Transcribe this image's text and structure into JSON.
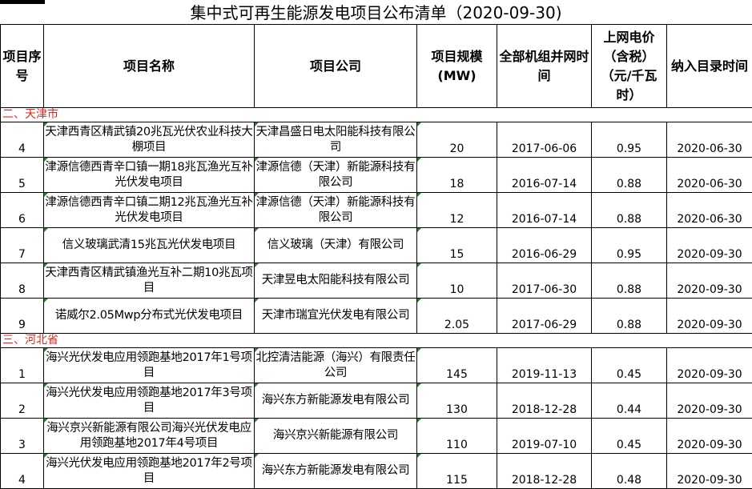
{
  "title": "集中式可再生能源发电项目公布清单（2020-09-30)",
  "headers": {
    "seq": "项目序号",
    "name": "项目名称",
    "company": "项目公司",
    "scale": "项目规模(MW)",
    "grid_time": "全部机组并网时间",
    "price": "上网电价（含税）（元/千瓦时）",
    "list_time": "纳入目录时间"
  },
  "sections": [
    {
      "label": "二、天津市",
      "rows": [
        {
          "seq": "4",
          "name": "天津西青区精武镇20兆瓦光伏农业科技大棚项目",
          "company": "天津昌盛日电太阳能科技有限公司",
          "scale": "20",
          "grid_time": "2017-06-06",
          "price": "0.95",
          "list_time": "2020-06-30"
        },
        {
          "seq": "5",
          "name": "津源信德西青辛口镇一期18兆瓦渔光互补光伏发电项目",
          "company": "津源信德（天津）新能源科技有限公司",
          "scale": "18",
          "grid_time": "2016-07-14",
          "price": "0.88",
          "list_time": "2020-06-30"
        },
        {
          "seq": "6",
          "name": "津源信德西青辛口镇二期12兆瓦渔光互补光伏发电项目",
          "company": "津源信德（天津）新能源科技有限公司",
          "scale": "12",
          "grid_time": "2016-07-14",
          "price": "0.88",
          "list_time": "2020-06-30"
        },
        {
          "seq": "7",
          "name": "信义玻璃武清15兆瓦光伏发电项目",
          "company": "信义玻璃（天津）有限公司",
          "scale": "15",
          "grid_time": "2016-06-29",
          "price": "0.95",
          "list_time": "2020-09-30"
        },
        {
          "seq": "8",
          "name": "天津西青区精武镇渔光互补二期10兆瓦项目",
          "company": "天津昱电太阳能科技有限公司",
          "scale": "10",
          "grid_time": "2017-06-30",
          "price": "0.88",
          "list_time": "2020-09-30"
        },
        {
          "seq": "9",
          "name": "诺威尔2.05Mwp分布式光伏发电项目",
          "company": "天津市瑞宜光伏发电有限公司",
          "scale": "2.05",
          "grid_time": "2017-06-29",
          "price": "0.88",
          "list_time": "2020-09-30"
        }
      ]
    },
    {
      "label": "三、河北省",
      "rows": [
        {
          "seq": "1",
          "name": "海兴光伏发电应用领跑基地2017年1号项目",
          "company": "北控清洁能源（海兴）有限责任公司",
          "scale": "145",
          "grid_time": "2019-11-13",
          "price": "0.45",
          "list_time": "2020-09-30"
        },
        {
          "seq": "2",
          "name": "海兴光伏发电应用领跑基地2017年3号项目",
          "company": "海兴东方新能源发电有限公司",
          "scale": "130",
          "grid_time": "2018-12-28",
          "price": "0.44",
          "list_time": "2020-09-30"
        },
        {
          "seq": "3",
          "name": "海兴京兴新能源有限公司海兴光伏发电应用领跑基地2017年4号项目",
          "company": "海兴京兴新能源有限公司",
          "scale": "110",
          "grid_time": "2019-07-10",
          "price": "0.45",
          "list_time": "2020-09-30"
        },
        {
          "seq": "4",
          "name": "海兴光伏发电应用领跑基地2017年2号项目",
          "company": "海兴东方新能源发电有限公司",
          "scale": "115",
          "grid_time": "2018-12-28",
          "price": "0.48",
          "list_time": "2020-09-30"
        }
      ]
    }
  ]
}
